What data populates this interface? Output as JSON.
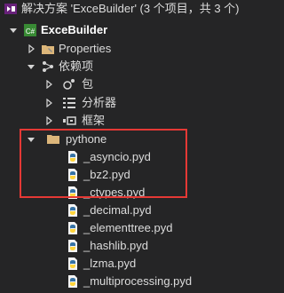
{
  "solution": {
    "label": "解决方案 'ExceBuilder' (3 个项目，共 3 个)",
    "icon": "solution-icon"
  },
  "project": {
    "label": "ExceBuilder",
    "icon": "csharp-project-icon"
  },
  "items": [
    {
      "label": "Properties",
      "icon": "wrench-folder-icon"
    },
    {
      "label": "依赖项",
      "icon": "dependencies-icon"
    },
    {
      "label": "包",
      "icon": "package-icon"
    },
    {
      "label": "分析器",
      "icon": "analyzer-icon"
    },
    {
      "label": "框架",
      "icon": "framework-icon"
    },
    {
      "label": "pythone",
      "icon": "folder-icon"
    },
    {
      "label": "_asyncio.pyd",
      "icon": "python-file-icon"
    },
    {
      "label": "_bz2.pyd",
      "icon": "python-file-icon"
    },
    {
      "label": "_ctypes.pyd",
      "icon": "python-file-icon"
    },
    {
      "label": "_decimal.pyd",
      "icon": "python-file-icon"
    },
    {
      "label": "_elementtree.pyd",
      "icon": "python-file-icon"
    },
    {
      "label": "_hashlib.pyd",
      "icon": "python-file-icon"
    },
    {
      "label": "_lzma.pyd",
      "icon": "python-file-icon"
    },
    {
      "label": "_multiprocessing.pyd",
      "icon": "python-file-icon"
    }
  ],
  "colors": {
    "background": "#252526",
    "highlight": "#e53935",
    "folder": "#dcb67a",
    "csharp": "#388a34",
    "python_blue": "#3572a5",
    "python_yellow": "#ffd43b"
  }
}
